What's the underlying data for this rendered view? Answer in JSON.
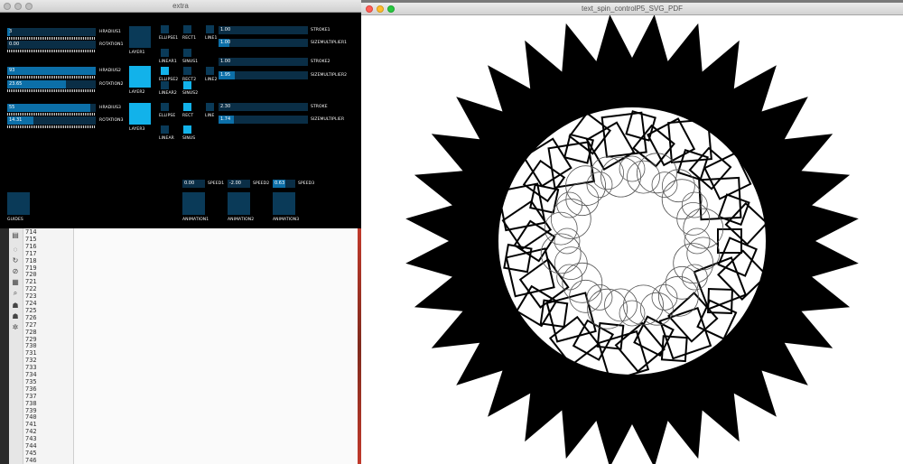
{
  "windows": {
    "extra_title": "extra",
    "spin_title": "text_spin_controlP5_SVG_PDF"
  },
  "editor": {
    "line_numbers": [
      "714",
      "715",
      "716",
      "717",
      "718",
      "719",
      "720",
      "721",
      "722",
      "723",
      "724",
      "725",
      "726",
      "727",
      "728",
      "729",
      "730",
      "731",
      "732",
      "733",
      "734",
      "735",
      "736",
      "737",
      "738",
      "739",
      "740",
      "741",
      "742",
      "743",
      "744",
      "745",
      "746"
    ]
  },
  "controls": {
    "radius1": {
      "value": "3",
      "label": "HRADIUS1",
      "fill": 0.03
    },
    "rotation1": {
      "value": "0.00",
      "label": "ROTATION1",
      "fill": 0.0
    },
    "radius2": {
      "value": "93",
      "label": "HRADIUS2",
      "fill": 1.0
    },
    "rotation2": {
      "value": "23.65",
      "label": "ROTATION2",
      "fill": 0.66
    },
    "radius3": {
      "value": "55",
      "label": "HRADIUS3",
      "fill": 0.94
    },
    "rotation3": {
      "value": "14.31",
      "label": "ROTATION3",
      "fill": 0.3
    },
    "layer1": "LAYER1",
    "layer2": "LAYER2",
    "layer3": "LAYER3",
    "ellipse1": "ELLIPSE1",
    "rect1": "RECT1",
    "line1": "LINE1",
    "linear1": "LINEAR1",
    "sinus1": "SINUS1",
    "ellipse2": "ELLIPSE2",
    "rect2": "RECT2",
    "line2": "LINE2",
    "linear2": "LINEAR2",
    "sinus2": "SINUS2",
    "ellipse": "ELLIPSE",
    "rect": "RECT",
    "line": "LINE",
    "linear": "LINEAR",
    "sinus": "SINUS",
    "stroke1": {
      "value": "1.00",
      "label": "STROKE1",
      "fill": 0.0
    },
    "sizemult1": {
      "value": "1.00",
      "label": "SIZEMULTIPLIER1",
      "fill": 0.12
    },
    "stroke2": {
      "value": "1.00",
      "label": "STROKE2",
      "fill": 0.0
    },
    "sizemult2": {
      "value": "1.95",
      "label": "SIZEMULTIPLIER2",
      "fill": 0.18
    },
    "stroke": {
      "value": "2.30",
      "label": "STROKE",
      "fill": 0.0
    },
    "sizemult": {
      "value": "1.74",
      "label": "SIZEMULTIPLIER",
      "fill": 0.17
    },
    "speed1": {
      "value": "0.00",
      "label": "SPEED1",
      "fill": 0.0
    },
    "speed2": {
      "value": "-2.00",
      "label": "SPEED2",
      "fill": 0.0
    },
    "speed3": {
      "value": "0.63",
      "label": "SPEED3",
      "fill": 0.55
    },
    "guides": "GUIDES",
    "anim1": "ANIMATION1",
    "anim2": "ANIMATION2",
    "anim3": "ANIMATION3"
  },
  "colors": {
    "track": "#0a2e46",
    "fill": "#0c6fa8",
    "toggle_off": "#0a3a58",
    "toggle_on": "#12b2ea"
  }
}
